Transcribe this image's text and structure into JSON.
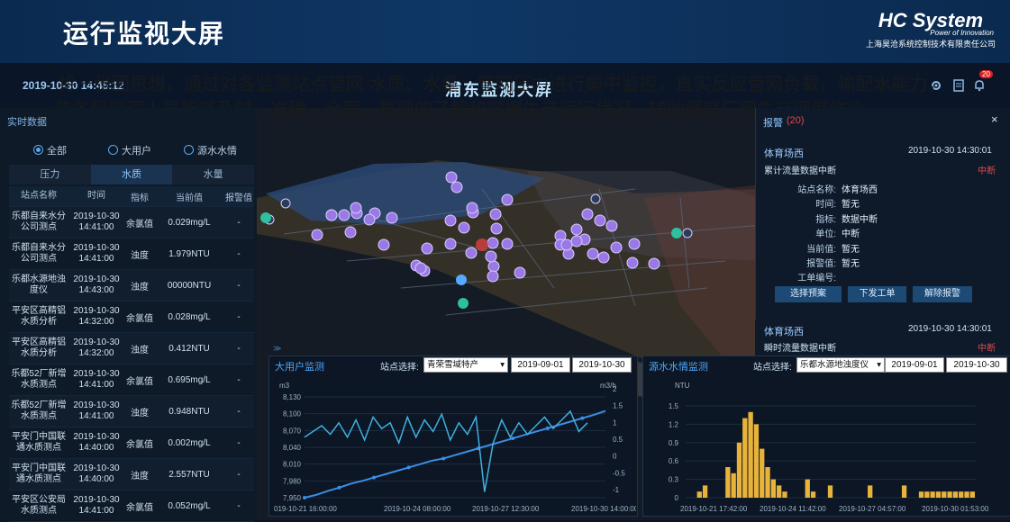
{
  "header": {
    "title": "运行监视大屏",
    "logo_name": "HC System",
    "logo_tagline": "Power of Innovation",
    "company": "上海昊沧系统控制技术有限责任公司"
  },
  "app": {
    "datetime": "2019-10-30 14:45:12",
    "screen_title": "浦东监测大屏",
    "bell_badge": "20"
  },
  "overlay_text": "将一张图思想，通过对各监测站点管网 水质、水量、管网压力进行集中监控，直实反应管网负载、输配水能力，使各级管理人员能够及时、准确、全面、直观的了解和掌握生产运行状况，辅助调度厂网生产调度作业。",
  "realtime": {
    "title": "实时数据",
    "filters": [
      {
        "label": "全部",
        "selected": true
      },
      {
        "label": "大用户",
        "selected": false
      },
      {
        "label": "源水水情",
        "selected": false
      }
    ],
    "tabs": [
      {
        "label": "压力",
        "active": false
      },
      {
        "label": "水质",
        "active": true
      },
      {
        "label": "水量",
        "active": false
      }
    ],
    "columns": [
      "站点名称",
      "时间",
      "指标",
      "当前值",
      "报警值"
    ],
    "rows": [
      {
        "site": "乐都自来水分公司测点",
        "date": "2019-10-30",
        "time": "14:41:00",
        "metric": "余氯值",
        "value": "0.029mg/L",
        "alarm": "-"
      },
      {
        "site": "乐都自来水分公司测点",
        "date": "2019-10-30",
        "time": "14:41:00",
        "metric": "浊度",
        "value": "1.979NTU",
        "alarm": "-"
      },
      {
        "site": "乐都水源地浊度仪",
        "date": "2019-10-30",
        "time": "14:43:00",
        "metric": "浊度",
        "value": "00000NTU",
        "alarm": "-"
      },
      {
        "site": "平安区高精铝水质分析",
        "date": "2019-10-30",
        "time": "14:32:00",
        "metric": "余氯值",
        "value": "0.028mg/L",
        "alarm": "-"
      },
      {
        "site": "平安区高精铝水质分析",
        "date": "2019-10-30",
        "time": "14:32:00",
        "metric": "浊度",
        "value": "0.412NTU",
        "alarm": "-"
      },
      {
        "site": "乐都52厂新增水质测点",
        "date": "2019-10-30",
        "time": "14:41:00",
        "metric": "余氯值",
        "value": "0.695mg/L",
        "alarm": "-"
      },
      {
        "site": "乐都52厂新增水质测点",
        "date": "2019-10-30",
        "time": "14:41:00",
        "metric": "浊度",
        "value": "0.948NTU",
        "alarm": "-"
      },
      {
        "site": "平安门中国联通水质测点",
        "date": "2019-10-30",
        "time": "14:40:00",
        "metric": "余氯值",
        "value": "0.002mg/L",
        "alarm": "-"
      },
      {
        "site": "平安门中国联通水质测点",
        "date": "2019-10-30",
        "time": "14:40:00",
        "metric": "浊度",
        "value": "2.557NTU",
        "alarm": "-"
      },
      {
        "site": "平安区公安局水质测点",
        "date": "2019-10-30",
        "time": "14:41:00",
        "metric": "余氯值",
        "value": "0.052mg/L",
        "alarm": "-"
      }
    ]
  },
  "alarm": {
    "title": "报警",
    "count": "(20)",
    "close": "×",
    "items": [
      {
        "site": "体育场西",
        "time": "2019-10-30 14:30:01",
        "desc": "累计流量数据中断",
        "state": "中断"
      },
      {
        "site": "体育场西",
        "time": "2019-10-30 14:30:01",
        "desc": "瞬时流量数据中断",
        "state": "中断"
      }
    ],
    "detail": [
      {
        "key": "站点名称:",
        "value": "体育场西"
      },
      {
        "key": "时间:",
        "value": "暂无"
      },
      {
        "key": "指标:",
        "value": "数据中断"
      },
      {
        "key": "单位:",
        "value": "中断"
      },
      {
        "key": "当前值:",
        "value": "暂无"
      },
      {
        "key": "报警值:",
        "value": "暂无"
      },
      {
        "key": "工单编号:",
        "value": ""
      }
    ],
    "buttons": [
      "选择预案",
      "下发工单",
      "解除报警"
    ]
  },
  "chart1_panel": {
    "title": "大用户监测",
    "station_label": "站点选择:",
    "station": "青荣雪域特产",
    "date_from": "2019-09-01",
    "date_to": "2019-10-30"
  },
  "chart2_panel": {
    "title": "源水水情监测",
    "station_label": "站点选择:",
    "station": "乐都水源地浊度仪",
    "date_from": "2019-09-01",
    "date_to": "2019-10-30"
  },
  "chart_data": [
    {
      "type": "line",
      "title": "大用户监测",
      "ylabel": "m3",
      "y2label": "m3/h",
      "ylim": [
        7950,
        8130
      ],
      "y2lim": [
        -1.5,
        2
      ],
      "yticks": [
        "8,130",
        "8,100",
        "8,070",
        "8,040",
        "8,010",
        "7,980",
        "7,950"
      ],
      "y2ticks": [
        "2",
        "1.5",
        "1",
        "0.5",
        "0",
        "-0.5",
        "-1"
      ],
      "xticks": [
        "019-10-21 16:00:00",
        "2019-10-24 08:00:00",
        "2019-10-27 12:30:00",
        "2019-10-30 14:00:00"
      ],
      "series": [
        {
          "axis": "left",
          "values": [
            7950,
            7955,
            7962,
            7968,
            7975,
            7980,
            7986,
            7992,
            7998,
            8004,
            8010,
            8016,
            8020,
            8026,
            8032,
            8038,
            8044,
            8050,
            8056,
            8062,
            8068,
            8074,
            8080,
            8086,
            8092,
            8098,
            8105
          ]
        },
        {
          "axis": "right",
          "values": [
            0.6,
            0.8,
            1.0,
            0.7,
            1.1,
            0.6,
            1.2,
            0.5,
            1.3,
            0.9,
            1.1,
            0.4,
            1.3,
            0.6,
            1.2,
            0.8,
            1.4,
            0.5,
            1.1,
            0.7,
            1.3,
            -1.3,
            0.4,
            1.2,
            0.6,
            1.1,
            0.7,
            1.0,
            1.3,
            0.9,
            1.2,
            1.5,
            0.8,
            1.1
          ]
        }
      ]
    },
    {
      "type": "bar",
      "title": "源水水情监测",
      "ylabel": "NTU",
      "ylim": [
        0,
        1.5
      ],
      "yticks": [
        "1.5",
        "1.2",
        "0.9",
        "0.6",
        "0.3",
        "0"
      ],
      "xticks": [
        "2019-10-21 17:42:00",
        "2019-10-24 11:42:00",
        "2019-10-27 04:57:00",
        "2019-10-30 01:53:00"
      ],
      "series": [
        {
          "name": "浊度",
          "values": [
            0,
            0,
            0.1,
            0.2,
            0,
            0,
            0,
            0.5,
            0.4,
            0.9,
            1.3,
            1.4,
            1.2,
            0.8,
            0.5,
            0.3,
            0.2,
            0.1,
            0,
            0,
            0,
            0.3,
            0.1,
            0,
            0,
            0.2,
            0,
            0,
            0,
            0,
            0,
            0,
            0.2,
            0,
            0,
            0,
            0,
            0,
            0.2,
            0,
            0,
            0.1,
            0.1,
            0.1,
            0.1,
            0.1,
            0.1,
            0.1,
            0.1,
            0.1,
            0.1
          ]
        }
      ]
    }
  ]
}
